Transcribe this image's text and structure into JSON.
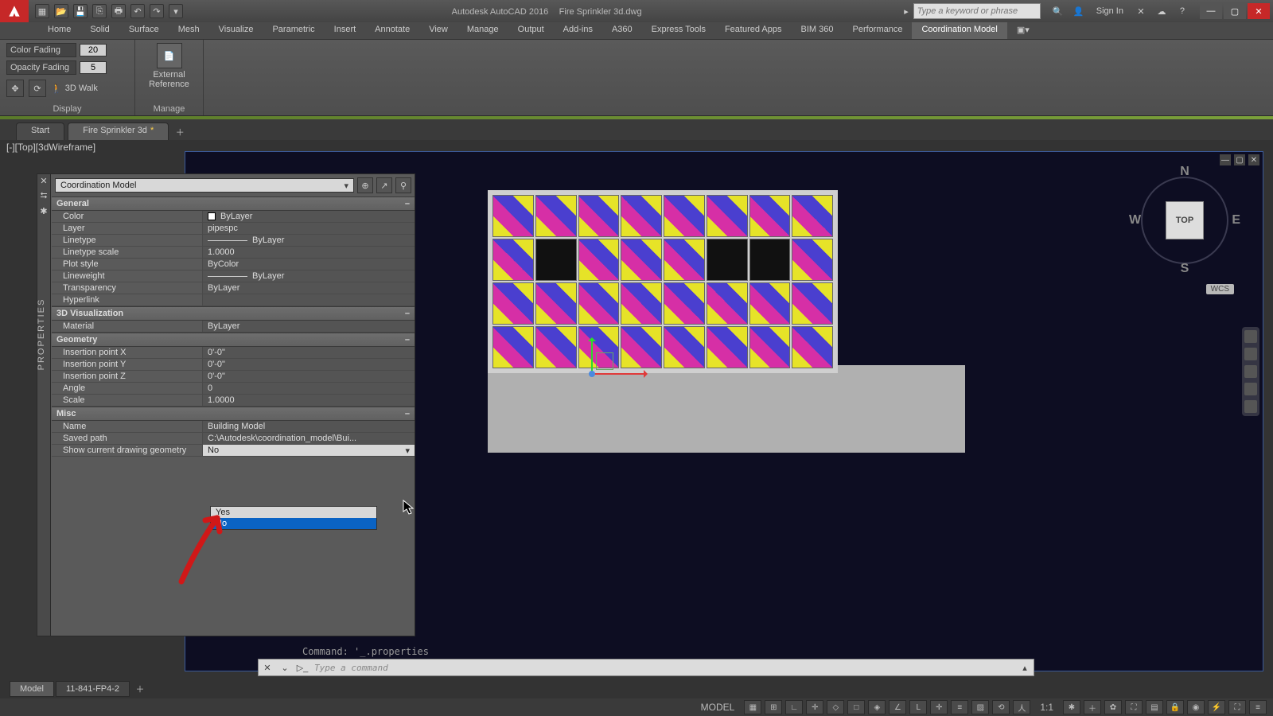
{
  "title": {
    "app": "Autodesk AutoCAD 2016",
    "file": "Fire Sprinkler 3d.dwg"
  },
  "search_placeholder": "Type a keyword or phrase",
  "signin": "Sign In",
  "ribbon_tabs": [
    "Home",
    "Solid",
    "Surface",
    "Mesh",
    "Visualize",
    "Parametric",
    "Insert",
    "Annotate",
    "View",
    "Manage",
    "Output",
    "Add-ins",
    "A360",
    "Express Tools",
    "Featured Apps",
    "BIM 360",
    "Performance",
    "Coordination Model"
  ],
  "ribbon_active": "Coordination Model",
  "display_panel": {
    "color_fading_label": "Color Fading",
    "color_fading_value": "20",
    "opacity_fading_label": "Opacity Fading",
    "opacity_fading_value": "5",
    "walk_label": "3D Walk",
    "title": "Display"
  },
  "manage_panel": {
    "button": "External\nReference",
    "title": "Manage"
  },
  "doc_tabs": {
    "start": "Start",
    "file": "Fire Sprinkler 3d"
  },
  "viewport_label": "[-][Top][3dWireframe]",
  "viewcube": {
    "top": "TOP",
    "n": "N",
    "s": "S",
    "e": "E",
    "w": "W",
    "wcs": "WCS"
  },
  "palette": {
    "side_label": "PROPERTIES",
    "object_type": "Coordination Model",
    "sections": {
      "general": {
        "title": "General",
        "rows": {
          "color": {
            "k": "Color",
            "v": "ByLayer"
          },
          "layer": {
            "k": "Layer",
            "v": "pipespc"
          },
          "linetype": {
            "k": "Linetype",
            "v": "ByLayer"
          },
          "ltscale": {
            "k": "Linetype scale",
            "v": "1.0000"
          },
          "plot": {
            "k": "Plot style",
            "v": "ByColor"
          },
          "lweight": {
            "k": "Lineweight",
            "v": "ByLayer"
          },
          "transp": {
            "k": "Transparency",
            "v": "ByLayer"
          },
          "hyper": {
            "k": "Hyperlink",
            "v": ""
          }
        }
      },
      "viz": {
        "title": "3D Visualization",
        "material": {
          "k": "Material",
          "v": "ByLayer"
        }
      },
      "geom": {
        "title": "Geometry",
        "ipx": {
          "k": "Insertion point X",
          "v": "0'-0\""
        },
        "ipy": {
          "k": "Insertion point Y",
          "v": "0'-0\""
        },
        "ipz": {
          "k": "Insertion point Z",
          "v": "0'-0\""
        },
        "angle": {
          "k": "Angle",
          "v": "0"
        },
        "scale": {
          "k": "Scale",
          "v": "1.0000"
        }
      },
      "misc": {
        "title": "Misc",
        "name": {
          "k": "Name",
          "v": "Building Model"
        },
        "path": {
          "k": "Saved path",
          "v": "C:\\Autodesk\\coordination_model\\Bui..."
        },
        "show": {
          "k": "Show current drawing geometry",
          "v": "No"
        }
      }
    },
    "dropdown": {
      "yes": "Yes",
      "no": "No"
    }
  },
  "command": {
    "echo": "Command: '_.properties",
    "placeholder": "Type a command"
  },
  "layout_tabs": {
    "model": "Model",
    "sheet": "11-841-FP4-2"
  },
  "status": {
    "space": "MODEL",
    "scale": "1:1"
  }
}
